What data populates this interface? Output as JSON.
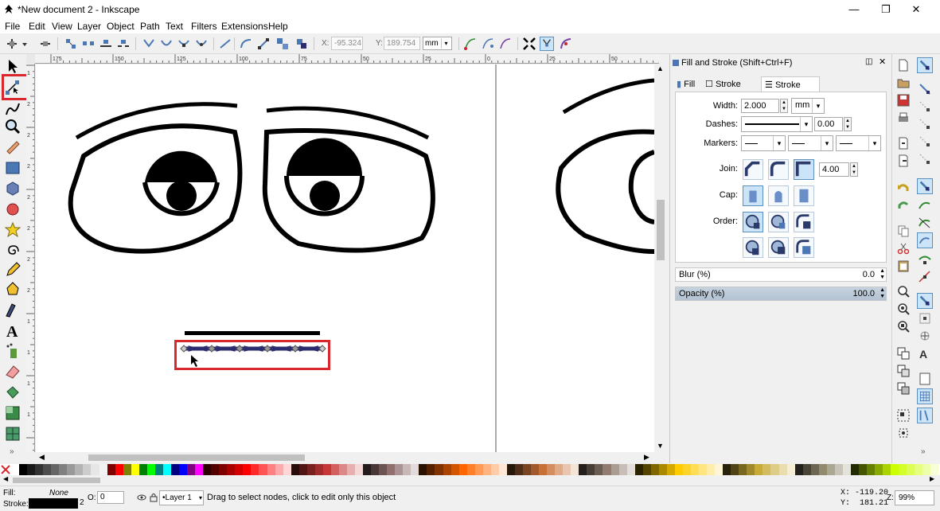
{
  "window": {
    "title": "*New document 2 - Inkscape",
    "minimize_glyph": "—",
    "restore_glyph": "❐",
    "close_glyph": "✕"
  },
  "menu": [
    "File",
    "Edit",
    "View",
    "Layer",
    "Object",
    "Path",
    "Text",
    "Filters",
    "Extensions",
    "Help"
  ],
  "toolbar": {
    "x_label": "X:",
    "x_value": "-95.324",
    "y_label": "Y:",
    "y_value": "189.754",
    "unit": "mm"
  },
  "rulers": {
    "h_ticks": [
      "175",
      "150",
      "125",
      "100",
      "75",
      "50",
      "25",
      "0",
      "25",
      "50",
      "75"
    ],
    "v_ticks": [
      "1",
      "2",
      "2",
      "2",
      "2",
      "2",
      "2",
      "2",
      "1",
      "1",
      "1",
      "1"
    ]
  },
  "dialog": {
    "title": "Fill and Stroke (Shift+Ctrl+F)",
    "tabs": [
      {
        "label": "Fill",
        "active": false
      },
      {
        "label": "Stroke paint",
        "active": false
      },
      {
        "label": "Stroke style",
        "active": true
      }
    ],
    "width_label": "Width:",
    "width_value": "2.000",
    "width_unit": "mm",
    "dashes_label": "Dashes:",
    "dashes_offset": "0.00",
    "markers_label": "Markers:",
    "join_label": "Join:",
    "miter_limit": "4.00",
    "cap_label": "Cap:",
    "order_label": "Order:",
    "blur_label": "Blur (%)",
    "blur_value": "0.0",
    "opacity_label": "Opacity (%)",
    "opacity_value": "100.0"
  },
  "status": {
    "fill_label": "Fill:",
    "fill_value": "None",
    "stroke_label": "Stroke:",
    "stroke_width": "2",
    "opacity_label": "O:",
    "opacity_value": "0",
    "layer": "•Layer 1",
    "message": "Drag to select nodes, click to edit only this object",
    "x_coord": "X: -119.20",
    "y_coord": "Y:  181.21",
    "zoom_label": "Z:",
    "zoom_value": "99%"
  },
  "colors": {
    "accent_red": "#d9272e",
    "selection_blue": "#2b2d6e",
    "palette": [
      "#ffffff",
      "#000000",
      "#1a1a1a",
      "#333333",
      "#4d4d4d",
      "#666666",
      "#808080",
      "#999999",
      "#b3b3b3",
      "#cccccc",
      "#e6e6e6",
      "#f2f2f2",
      "#800000",
      "#ff0000",
      "#808000",
      "#ffff00",
      "#008000",
      "#00ff00",
      "#008080",
      "#00ffff",
      "#000080",
      "#0000ff",
      "#800080",
      "#ff00ff",
      "#2b0000",
      "#550000",
      "#800000",
      "#aa0000",
      "#d40000",
      "#ff0000",
      "#ff2a2a",
      "#ff5555",
      "#ff8080",
      "#ffaaaa",
      "#ffd5d5",
      "#280b0b",
      "#501616",
      "#782121",
      "#a02c2c",
      "#c83737",
      "#d35f5f",
      "#de8787",
      "#e9afaf",
      "#f4d7d7",
      "#241c1c",
      "#483737",
      "#6c5353",
      "#916f6f",
      "#ac9393",
      "#c8b7b7",
      "#e3dbdb",
      "#2b1100",
      "#552200",
      "#803300",
      "#aa4400",
      "#d45500",
      "#ff6600",
      "#ff7f2a",
      "#ff9955",
      "#ffb380",
      "#ffccaa",
      "#ffe6d5",
      "#28170b",
      "#502d16",
      "#784421",
      "#a05a2c",
      "#c87137",
      "#d38d5f",
      "#deaa87",
      "#e9c6af",
      "#f4e3d7",
      "#241f1c",
      "#483e37",
      "#6c5d53",
      "#917c6f",
      "#ac9d93",
      "#c8beb7",
      "#e3dedb",
      "#2b2200",
      "#554400",
      "#806600",
      "#aa8800",
      "#d4aa00",
      "#ffcc00",
      "#ffd42a",
      "#ffdd55",
      "#ffe680",
      "#ffeeaa",
      "#fff6d5",
      "#28220b",
      "#504416",
      "#786721",
      "#a0892c",
      "#c8ab37",
      "#d3bc5f",
      "#decd87",
      "#e9ddaf",
      "#f4eed7",
      "#24221c",
      "#484537",
      "#6c6753",
      "#918a6f",
      "#aca793",
      "#c8c4b7",
      "#e3e2db",
      "#222b00",
      "#445500",
      "#668000",
      "#88aa00",
      "#aad400",
      "#ccff00",
      "#d4ff2a",
      "#ddff55",
      "#e5ff80",
      "#eeffaa",
      "#f6ffd5"
    ]
  }
}
